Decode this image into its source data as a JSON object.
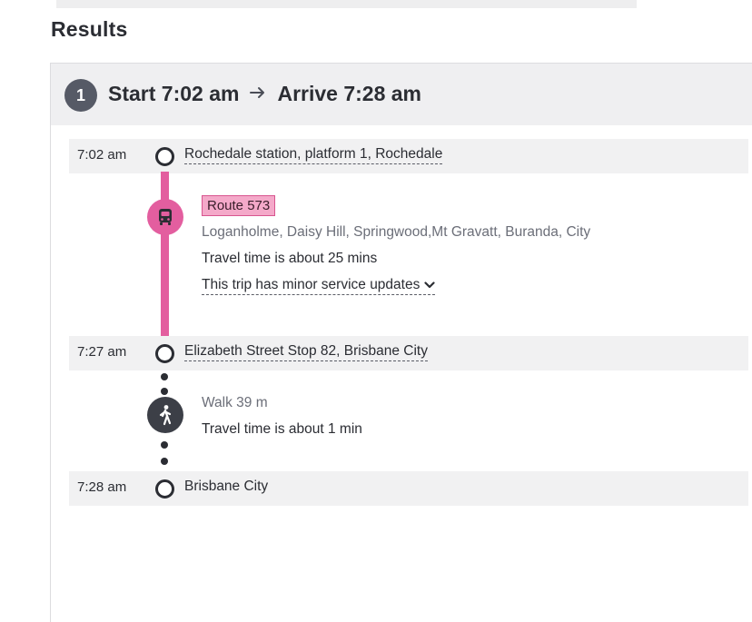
{
  "results": {
    "heading": "Results"
  },
  "trip": {
    "number": "1",
    "start": "Start 7:02 am",
    "arrive": "Arrive 7:28 am",
    "arrow_icon": "arrow-right-icon"
  },
  "stops": [
    {
      "time": "7:02 am",
      "name": "Rochedale station, platform 1, Rochedale",
      "is_link": true
    },
    {
      "time": "7:27 am",
      "name": "Elizabeth Street Stop 82, Brisbane City",
      "is_link": true
    },
    {
      "time": "7:28 am",
      "name": "Brisbane City",
      "is_link": false
    }
  ],
  "bus_leg": {
    "icon": "bus-icon",
    "route": "Route 573",
    "via": "Loganholme, Daisy Hill, Springwood,Mt Gravatt, Buranda, City",
    "travel_time": "Travel time is about 25 mins",
    "service_updates": "This trip has minor service updates",
    "service_updates_icon": "chevron-down-icon",
    "color": "#e35e9f"
  },
  "walk_leg": {
    "icon": "walking-person-icon",
    "distance": "Walk 39 m",
    "travel_time": "Travel time is about 1 min"
  }
}
